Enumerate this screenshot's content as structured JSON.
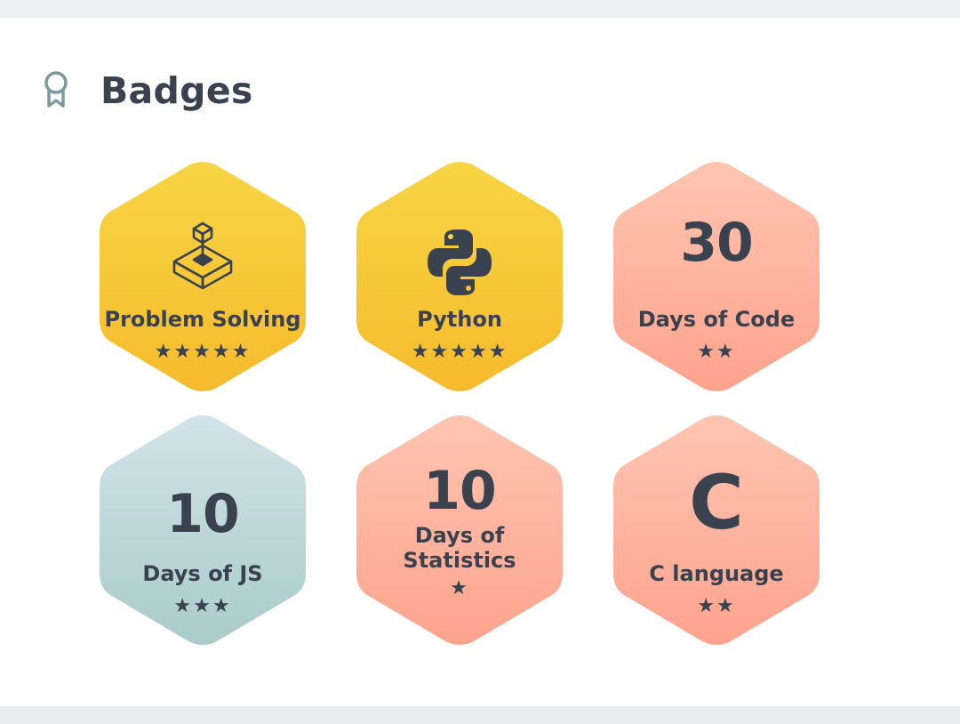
{
  "section": {
    "title": "Badges",
    "icon": "ribbon-award-icon"
  },
  "badges": [
    {
      "label": "Problem Solving",
      "stars": 5,
      "stars_text": "★★★★★",
      "icon": "isometric-joystick-icon",
      "color": "gold"
    },
    {
      "label": "Python",
      "stars": 5,
      "stars_text": "★★★★★",
      "icon": "python-logo-icon",
      "color": "gold"
    },
    {
      "number": "30",
      "label": "Days of Code",
      "stars": 2,
      "stars_text": "★★",
      "color": "salmon"
    },
    {
      "number": "10",
      "label": "Days of JS",
      "stars": 3,
      "stars_text": "★★★",
      "color": "blue-gray"
    },
    {
      "number": "10",
      "label_line1": "Days of",
      "label_line2": "Statistics",
      "stars": 1,
      "stars_text": "★",
      "color": "salmon"
    },
    {
      "letter": "C",
      "label": "C language",
      "stars": 2,
      "stars_text": "★★",
      "color": "salmon"
    }
  ],
  "colors": {
    "gold_top": "#f7d544",
    "gold_bottom": "#f6bb2c",
    "salmon_top": "#fec5b1",
    "salmon_bottom": "#fda38d",
    "bluegray_top": "#d1e3ea",
    "bluegray_bottom": "#aacbc9",
    "text": "#39424e"
  }
}
